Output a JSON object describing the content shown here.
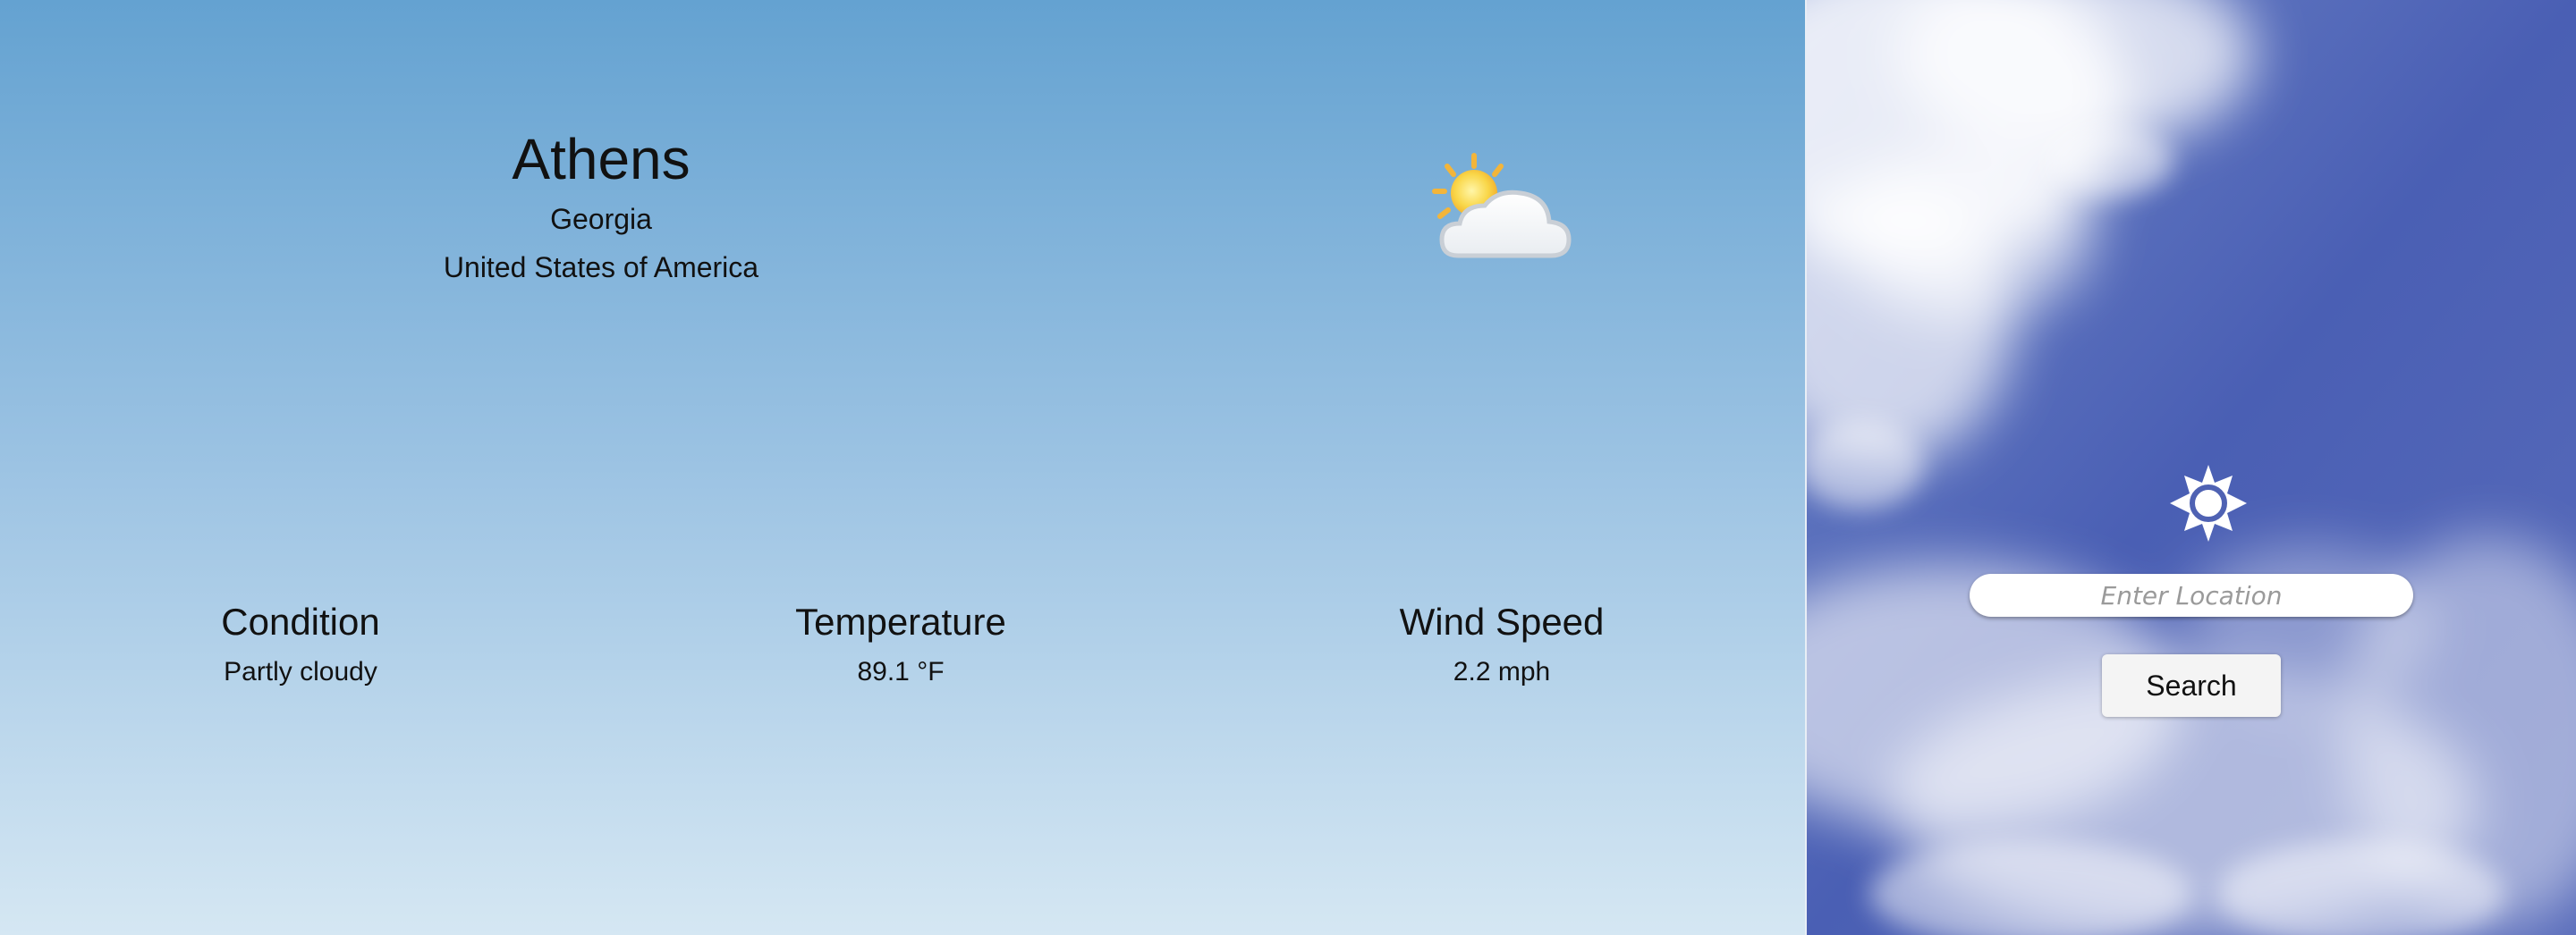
{
  "weather": {
    "city": "Athens",
    "region": "Georgia",
    "country": "United States of America",
    "icon": "partly-cloudy-icon",
    "stats": {
      "condition": {
        "label": "Condition",
        "value": "Partly cloudy"
      },
      "temperature": {
        "label": "Temperature",
        "value": "89.1 °F"
      },
      "wind": {
        "label": "Wind Speed",
        "value": "2.2 mph"
      }
    }
  },
  "search": {
    "brand_icon": "sun-icon",
    "placeholder": "Enter Location",
    "button_label": "Search"
  },
  "colors": {
    "sky_top": "#64a2d1",
    "sky_bottom": "#d5e7f3",
    "search_bg": "#4f62b3",
    "sun_yellow": "#f7c23a",
    "cloud_white": "#ffffff"
  }
}
